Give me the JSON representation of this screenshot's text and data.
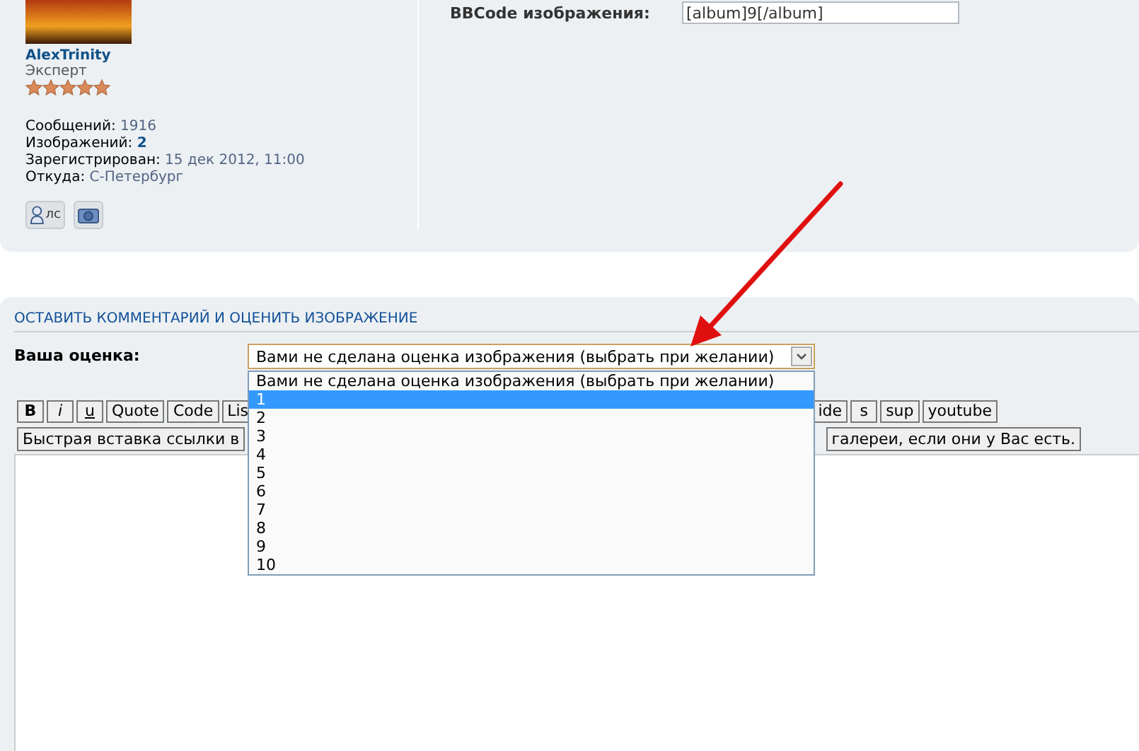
{
  "profile": {
    "username": "AlexTrinity",
    "rank": "Эксперт",
    "stars": 5,
    "stats": [
      {
        "label": "Сообщений:",
        "value": "1916",
        "bold": false
      },
      {
        "label": "Изображений:",
        "value": "2",
        "bold": true
      },
      {
        "label": "Зарегистрирован:",
        "value": "15 дек 2012, 11:00",
        "bold": false
      },
      {
        "label": "Откуда:",
        "value": "С-Петербург",
        "bold": false
      }
    ],
    "pm_button": "лс"
  },
  "bbcode": {
    "label": "BBCode изображения:",
    "value": "[album]9[/album]"
  },
  "comment": {
    "heading": "ОСТАВИТЬ КОММЕНТАРИЙ И ОЦЕНИТЬ ИЗОБРАЖЕНИЕ",
    "rating_label": "Ваша оценка:",
    "rating_select": {
      "value": "Вами не сделана оценка изображения (выбрать при желании)",
      "expanded": true,
      "options": [
        {
          "label": "Вами не сделана оценка изображения (выбрать при желании)",
          "highlighted": false
        },
        {
          "label": "1",
          "highlighted": true
        },
        {
          "label": "2",
          "highlighted": false
        },
        {
          "label": "3",
          "highlighted": false
        },
        {
          "label": "4",
          "highlighted": false
        },
        {
          "label": "5",
          "highlighted": false
        },
        {
          "label": "6",
          "highlighted": false
        },
        {
          "label": "7",
          "highlighted": false
        },
        {
          "label": "8",
          "highlighted": false
        },
        {
          "label": "9",
          "highlighted": false
        },
        {
          "label": "10",
          "highlighted": false
        }
      ]
    },
    "toolbar_left": [
      {
        "label": "B",
        "kind": "bold"
      },
      {
        "label": "i",
        "kind": "italic"
      },
      {
        "label": "u",
        "kind": "underline"
      },
      {
        "label": "Quote",
        "kind": "plain"
      },
      {
        "label": "Code",
        "kind": "plain"
      },
      {
        "label": "Lis",
        "kind": "plain"
      }
    ],
    "toolbar_right": [
      "ide",
      "s",
      "sup",
      "youtube"
    ],
    "quick_link_left": "Быстрая вставка ссылки в",
    "quick_link_right": "галереи, если они у Вас есть."
  }
}
